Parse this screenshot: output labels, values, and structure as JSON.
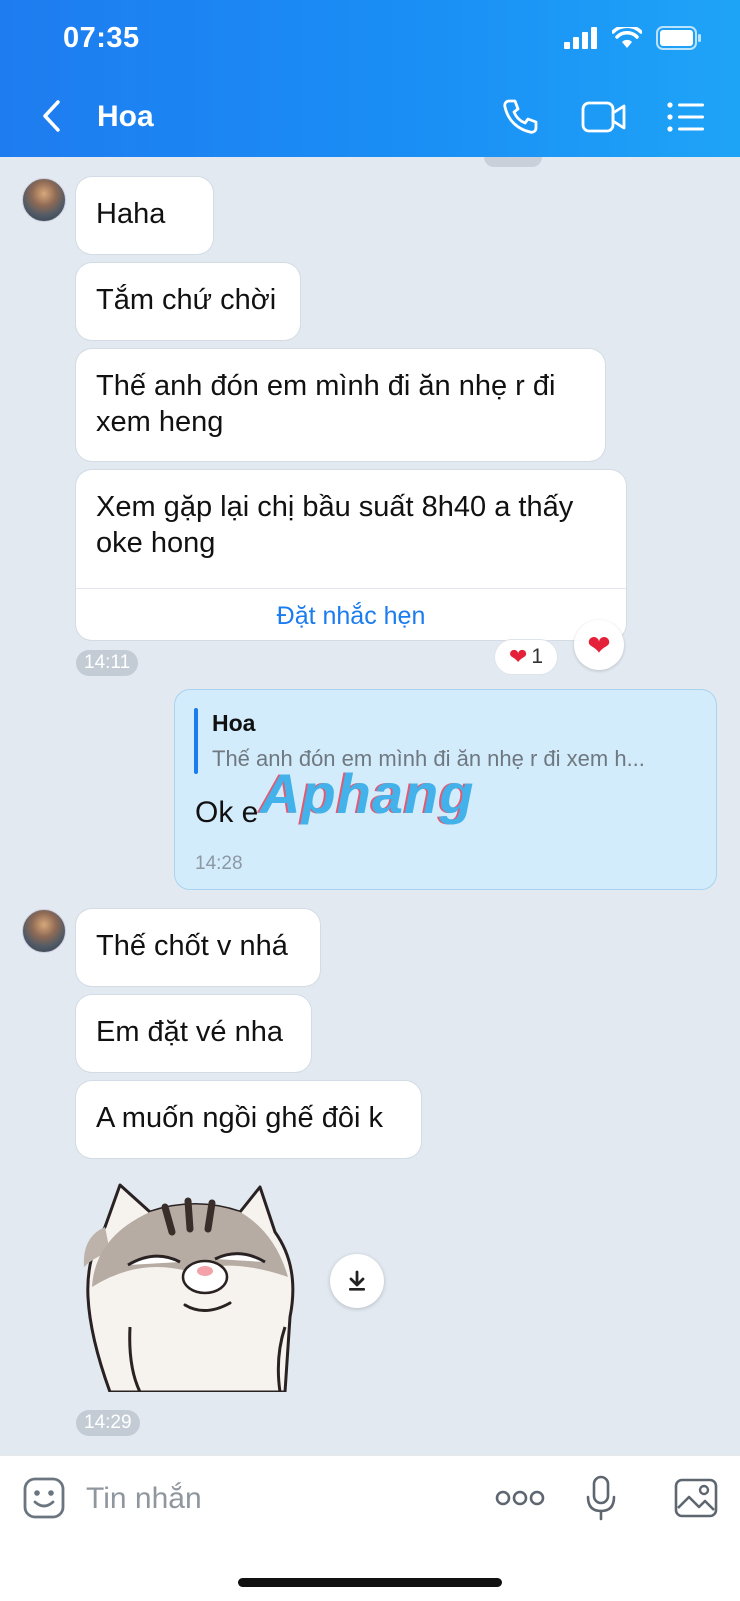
{
  "status_bar": {
    "time": "07:35"
  },
  "header": {
    "contact_name": "Hoa"
  },
  "messages_received_1": [
    {
      "text": "Haha"
    },
    {
      "text": "Tắm chứ chời"
    },
    {
      "text": "Thế anh đón em mình đi ăn nhẹ r đi xem heng"
    },
    {
      "text": "Xem gặp lại chị bầu suất 8h40 a thấy oke hong",
      "action": "Đặt nhắc hẹn"
    }
  ],
  "group1_time": "14:11",
  "reaction": {
    "count": "1",
    "emoji": "❤"
  },
  "sent_message": {
    "quote_author": "Hoa",
    "quote_text": "Thế anh đón em mình đi ăn nhẹ r đi xem h...",
    "text": "Ok e",
    "time": "14:28"
  },
  "watermark": "Aphang",
  "messages_received_2": [
    {
      "text": "Thế chốt v nhá"
    },
    {
      "text": "Em đặt vé nha"
    },
    {
      "text": "A muốn ngồi ghế đôi k"
    }
  ],
  "group2_time": "14:29",
  "composer": {
    "placeholder": "Tin nhắn"
  },
  "colors": {
    "header": "#1a8ef5",
    "accent": "#1b7cf0",
    "sent_bubble": "#d3ecfb",
    "background": "#e2e9f1"
  }
}
